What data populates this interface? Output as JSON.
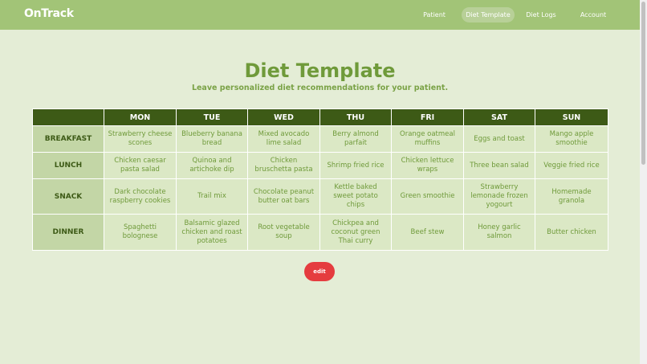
{
  "brand": "OnTrack",
  "nav": [
    {
      "label": "Patient",
      "active": false
    },
    {
      "label": "Diet Template",
      "active": true
    },
    {
      "label": "Diet Logs",
      "active": false
    },
    {
      "label": "Account",
      "active": false
    }
  ],
  "page": {
    "title": "Diet Template",
    "subtitle": "Leave personalized diet recommendations for your patient."
  },
  "table": {
    "days": [
      "MON",
      "TUE",
      "WED",
      "THU",
      "FRI",
      "SAT",
      "SUN"
    ],
    "rows": [
      {
        "meal": "BREAKFAST",
        "cells": [
          "Strawberry cheese scones",
          "Blueberry banana bread",
          "Mixed avocado lime salad",
          "Berry almond parfait",
          "Orange oatmeal muffins",
          "Eggs and toast",
          "Mango apple smoothie"
        ]
      },
      {
        "meal": "LUNCH",
        "cells": [
          "Chicken caesar pasta salad",
          "Quinoa and artichoke dip",
          "Chicken bruschetta pasta",
          "Shrimp fried rice",
          "Chicken lettuce wraps",
          "Three bean salad",
          "Veggie fried rice"
        ]
      },
      {
        "meal": "SNACK",
        "cells": [
          "Dark chocolate raspberry cookies",
          "Trail mix",
          "Chocolate peanut butter oat bars",
          "Kettle baked sweet potato chips",
          "Green smoothie",
          "Strawberry lemonade frozen yogourt",
          "Homemade granola"
        ]
      },
      {
        "meal": "DINNER",
        "cells": [
          "Spaghetti bolognese",
          "Balsamic glazed chicken and roast potatoes",
          "Root vegetable soup",
          "Chickpea and coconut green Thai curry",
          "Beef stew",
          "Honey garlic salmon",
          "Butter chicken"
        ]
      }
    ]
  },
  "edit_label": "edit",
  "colors": {
    "navbar": "#a2c477",
    "background": "#e4edd6",
    "header_row": "#3d5a16",
    "meal_cell": "#c3d6a6",
    "food_cell": "#dbe8c5",
    "title": "#6f9a3a",
    "edit_button": "#e53c3f"
  }
}
